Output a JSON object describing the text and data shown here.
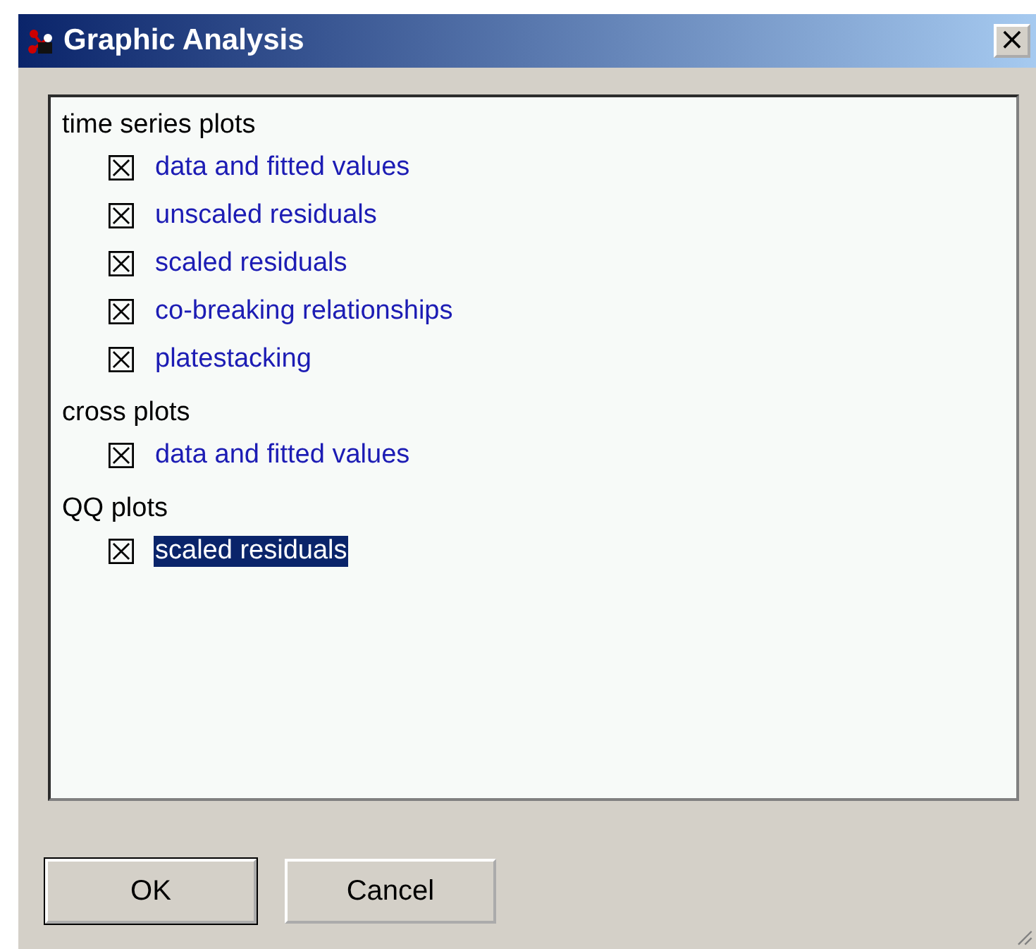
{
  "window": {
    "title": "Graphic Analysis",
    "close": "×"
  },
  "groups": [
    {
      "label": "time series plots",
      "children": [
        {
          "label": "data and fitted values",
          "checked": true,
          "selected": false
        },
        {
          "label": "unscaled residuals",
          "checked": true,
          "selected": false
        },
        {
          "label": "scaled residuals",
          "checked": true,
          "selected": false
        },
        {
          "label": "co-breaking relationships",
          "checked": true,
          "selected": false
        },
        {
          "label": "platestacking",
          "checked": true,
          "selected": false
        }
      ]
    },
    {
      "label": "cross  plots",
      "children": [
        {
          "label": "data and fitted values",
          "checked": true,
          "selected": false
        }
      ]
    },
    {
      "label": "QQ  plots",
      "children": [
        {
          "label": "scaled residuals",
          "checked": true,
          "selected": true
        }
      ]
    }
  ],
  "buttons": [
    {
      "label": "OK",
      "default": true
    },
    {
      "label": "Cancel",
      "default": false
    }
  ]
}
